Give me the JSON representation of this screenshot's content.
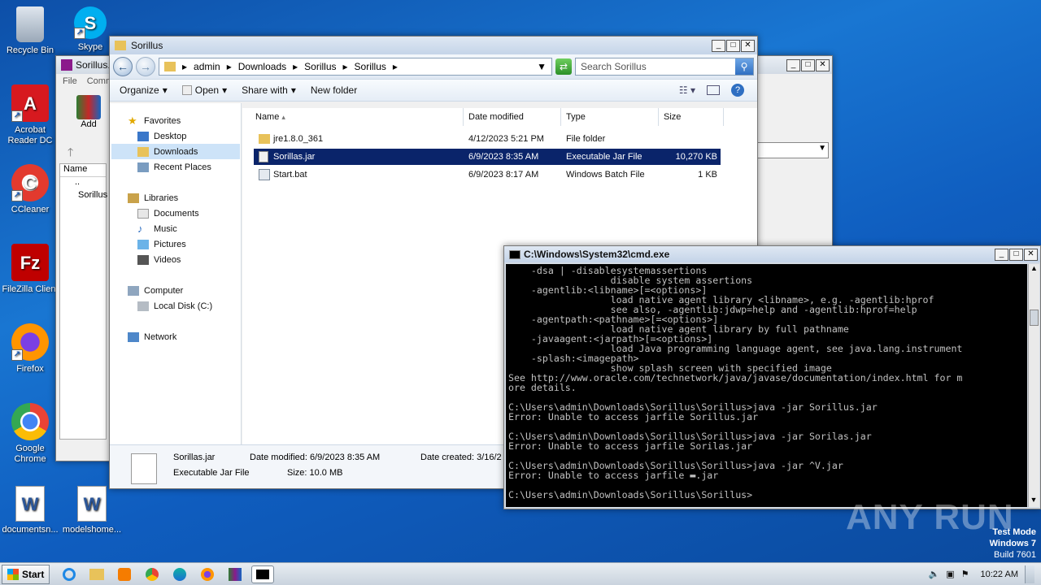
{
  "desktop": {
    "icons": [
      {
        "label": "Recycle Bin",
        "icon": "recycle-bin-icon"
      },
      {
        "label": "Skype",
        "icon": "skype-icon"
      },
      {
        "label": "Acrobat Reader DC",
        "icon": "acrobat-icon"
      },
      {
        "label": "CCleaner",
        "icon": "ccleaner-icon"
      },
      {
        "label": "FileZilla Client",
        "icon": "filezilla-icon"
      },
      {
        "label": "Firefox",
        "icon": "firefox-icon"
      },
      {
        "label": "Google Chrome",
        "icon": "chrome-icon"
      },
      {
        "label": "documentsn...",
        "icon": "word-document-icon"
      },
      {
        "label": "modelshome...",
        "icon": "word-document-icon"
      }
    ]
  },
  "back_window": {
    "title": "Sorillus.",
    "menu": [
      "File",
      "Comm"
    ],
    "add_label": "Add",
    "col_name": "Name",
    "rows": [
      "..",
      "Sorillus"
    ]
  },
  "explorer": {
    "title": "Sorillus",
    "breadcrumb": [
      "admin",
      "Downloads",
      "Sorillus",
      "Sorillus"
    ],
    "search_placeholder": "Search Sorillus",
    "toolbar": {
      "organize": "Organize",
      "open": "Open",
      "share": "Share with",
      "new_folder": "New folder"
    },
    "nav": {
      "favorites": "Favorites",
      "desktop": "Desktop",
      "downloads": "Downloads",
      "recent": "Recent Places",
      "libraries": "Libraries",
      "documents": "Documents",
      "music": "Music",
      "pictures": "Pictures",
      "videos": "Videos",
      "computer": "Computer",
      "localdisk": "Local Disk (C:)",
      "network": "Network"
    },
    "columns": {
      "name": "Name",
      "date": "Date modified",
      "type": "Type",
      "size": "Size"
    },
    "files": [
      {
        "name": "jre1.8.0_361",
        "date": "4/12/2023 5:21 PM",
        "type": "File folder",
        "size": "",
        "icon": "folder-icon"
      },
      {
        "name": "Sorillas.jar",
        "date": "6/9/2023 8:35 AM",
        "type": "Executable Jar File",
        "size": "10,270 KB",
        "icon": "jar-file-icon"
      },
      {
        "name": "Start.bat",
        "date": "6/9/2023 8:17 AM",
        "type": "Windows Batch File",
        "size": "1 KB",
        "icon": "batch-file-icon"
      }
    ],
    "status": {
      "filename": "Sorillas.jar",
      "filetype": "Executable Jar File",
      "modified": "Date modified: 6/9/2023 8:35 AM",
      "size": "Size: 10.0 MB",
      "created": "Date created: 3/16/2"
    }
  },
  "cmd": {
    "title": "C:\\Windows\\System32\\cmd.exe",
    "lines": [
      "    -dsa | -disablesystemassertions",
      "                  disable system assertions",
      "    -agentlib:<libname>[=<options>]",
      "                  load native agent library <libname>, e.g. -agentlib:hprof",
      "                  see also, -agentlib:jdwp=help and -agentlib:hprof=help",
      "    -agentpath:<pathname>[=<options>]",
      "                  load native agent library by full pathname",
      "    -javaagent:<jarpath>[=<options>]",
      "                  load Java programming language agent, see java.lang.instrument",
      "    -splash:<imagepath>",
      "                  show splash screen with specified image",
      "See http://www.oracle.com/technetwork/java/javase/documentation/index.html for m",
      "ore details.",
      "",
      "C:\\Users\\admin\\Downloads\\Sorillus\\Sorillus>java -jar Sorillus.jar",
      "Error: Unable to access jarfile Sorillus.jar",
      "",
      "C:\\Users\\admin\\Downloads\\Sorillus\\Sorillus>java -jar Sorilas.jar",
      "Error: Unable to access jarfile Sorilas.jar",
      "",
      "C:\\Users\\admin\\Downloads\\Sorillus\\Sorillus>java -jar ^V.jar",
      "Error: Unable to access jarfile ▬.jar",
      "",
      "C:\\Users\\admin\\Downloads\\Sorillus\\Sorillus>"
    ]
  },
  "watermark": {
    "brand": "ANY RUN",
    "line1": "Test Mode",
    "line2": "Windows 7",
    "line3": "Build 7601"
  },
  "taskbar": {
    "start_label": "Start",
    "clock": "10:22 AM"
  }
}
